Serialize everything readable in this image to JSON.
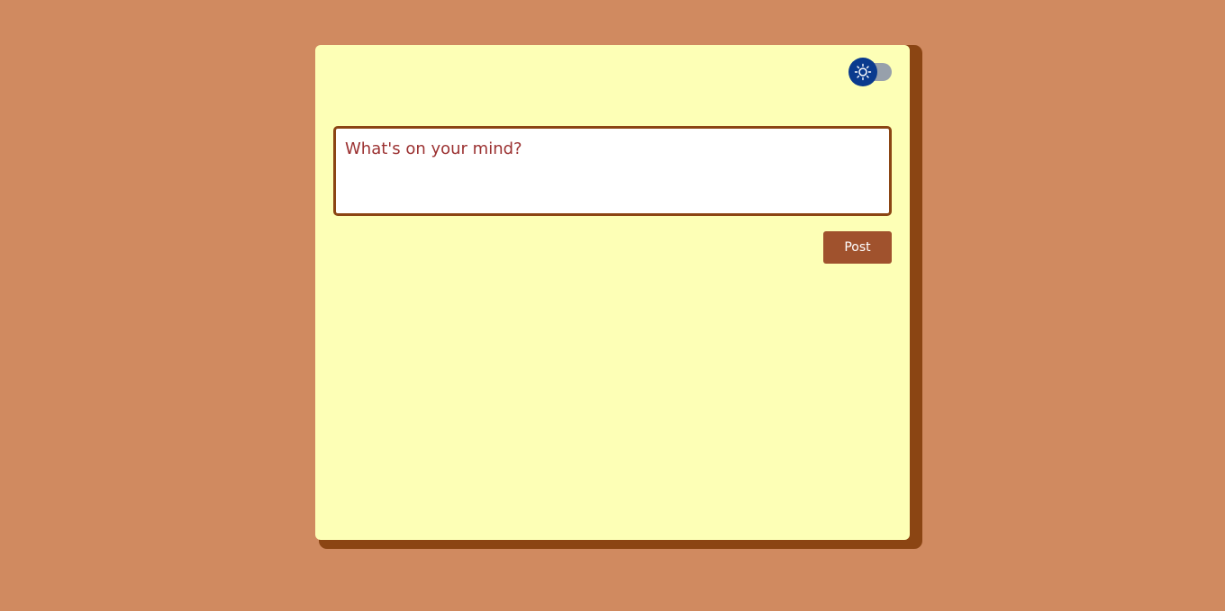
{
  "composer": {
    "placeholder": "What's on your mind?"
  },
  "actions": {
    "post_label": "Post"
  },
  "theme_toggle": {
    "mode": "light",
    "icon": "sun-icon"
  },
  "colors": {
    "page_background": "#D08A60",
    "card_background": "#FDFFB6",
    "card_shadow": "#8B4513",
    "accent": "#A0522D",
    "placeholder_text": "#9B3131",
    "toggle_knob": "#0A3A8E",
    "toggle_track": "#97A0AB"
  }
}
